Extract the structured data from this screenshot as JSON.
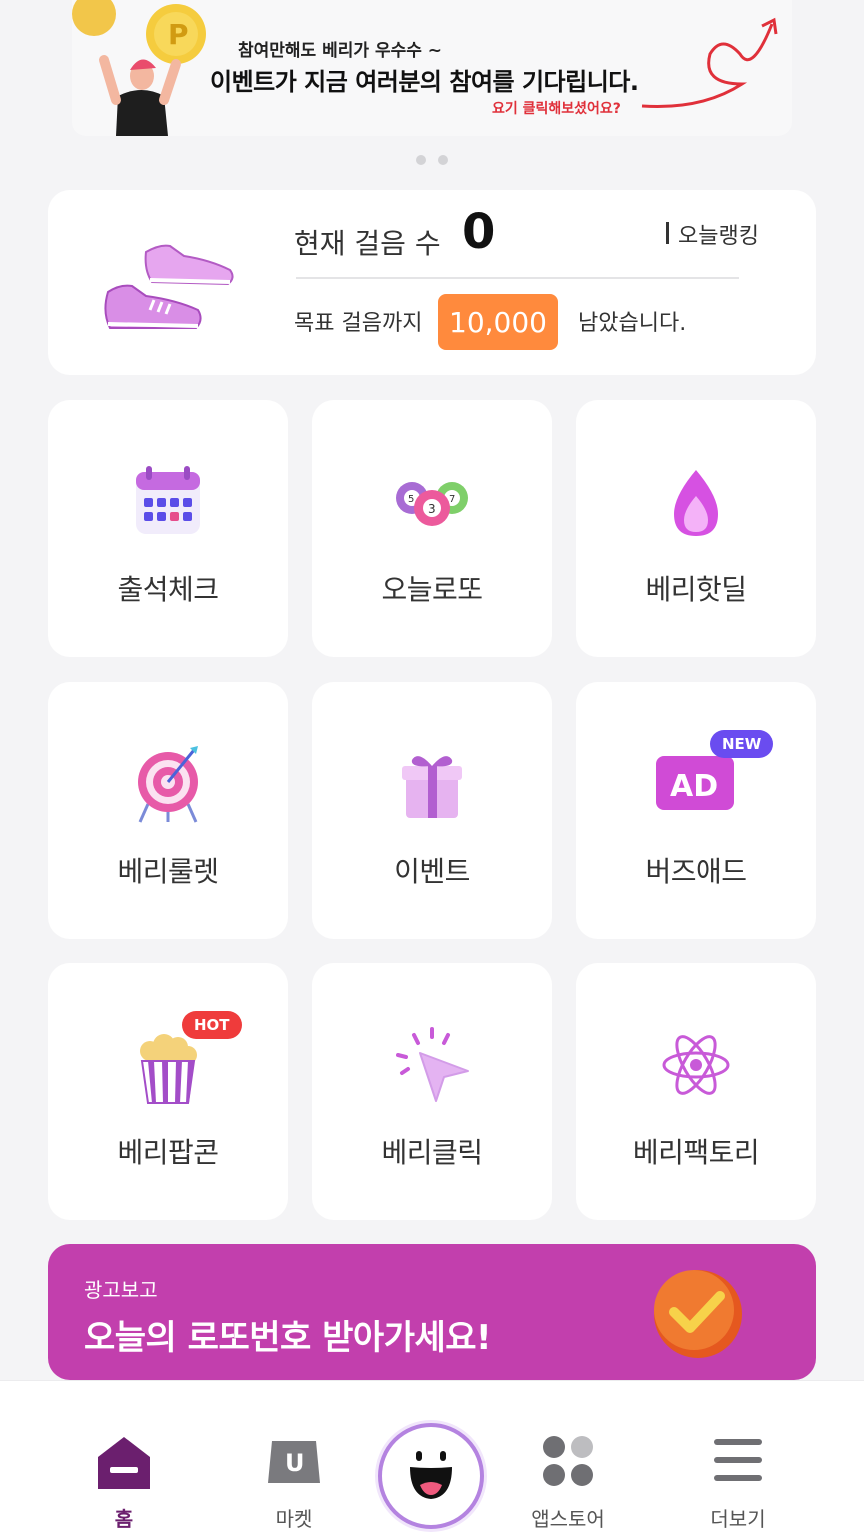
{
  "banner": {
    "subtitle": "참여만해도 베리가 우수수 ~",
    "title": "이벤트가 지금 여러분의 참여를 기다립니다.",
    "link": "요기 클릭해보셨어요?",
    "page_dots": 2
  },
  "steps": {
    "label": "현재 걸음 수",
    "count": "0",
    "ranking": "오늘랭킹",
    "goal_label": "목표 걸음까지",
    "goal_value": "10,000",
    "goal_suffix": "남았습니다."
  },
  "tiles": [
    {
      "label": "출석체크",
      "icon": "calendar-icon"
    },
    {
      "label": "오늘로또",
      "icon": "lotto-balls-icon"
    },
    {
      "label": "베리핫딜",
      "icon": "flame-icon"
    },
    {
      "label": "베리룰렛",
      "icon": "target-icon"
    },
    {
      "label": "이벤트",
      "icon": "gift-icon"
    },
    {
      "label": "버즈애드",
      "icon": "ad-icon",
      "badge": "NEW",
      "icon_text": "AD"
    },
    {
      "label": "베리팝콘",
      "icon": "popcorn-icon",
      "badge": "HOT"
    },
    {
      "label": "베리클릭",
      "icon": "cursor-click-icon"
    },
    {
      "label": "베리팩토리",
      "icon": "atom-icon"
    }
  ],
  "promo": {
    "small": "광고보고",
    "big": "오늘의 로또번호 받아가세요!"
  },
  "nav": {
    "items": [
      {
        "label": "홈",
        "icon": "home-icon",
        "active": true
      },
      {
        "label": "마켓",
        "icon": "market-bag-icon",
        "icon_text": "U"
      },
      {
        "label": "",
        "icon": "smile-face-icon"
      },
      {
        "label": "앱스토어",
        "icon": "apps-grid-icon"
      },
      {
        "label": "더보기",
        "icon": "menu-icon"
      }
    ]
  },
  "colors": {
    "accent_purple": "#c23fad",
    "goal_orange": "#ff8a3d",
    "badge_new": "#6a4cf0",
    "badge_hot": "#ef3b3b",
    "nav_active": "#6b1f6e"
  }
}
